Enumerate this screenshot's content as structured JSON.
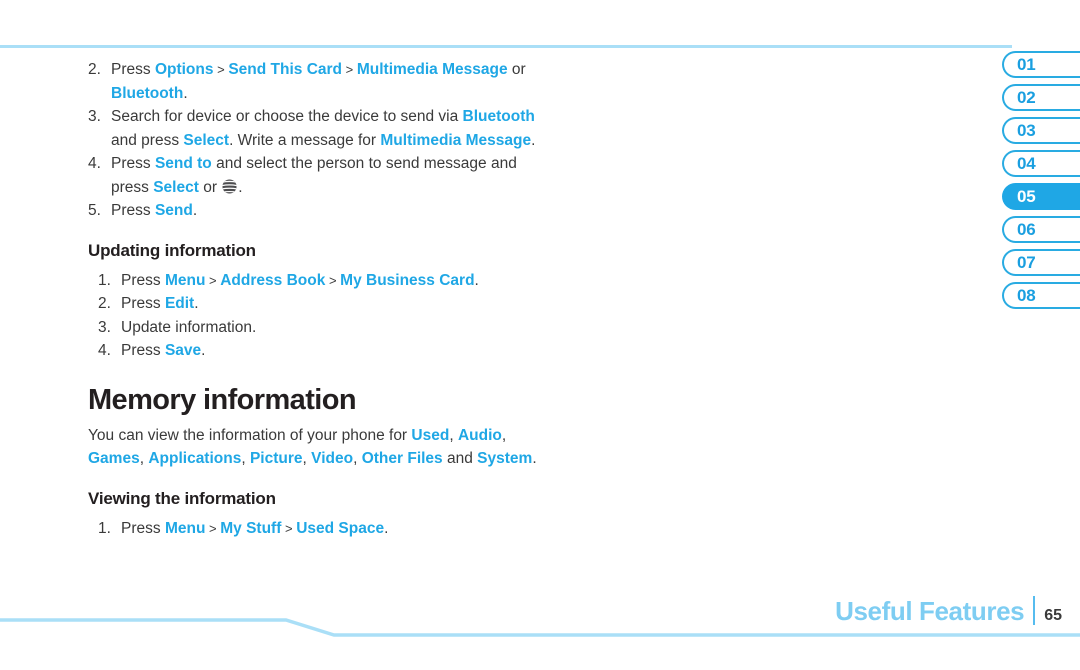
{
  "colors": {
    "accent_blue": "#1fa7e5",
    "light_blue_rule": "#aadff7",
    "tab_border": "#29abe2",
    "tab_active_fill": "#1fa7e5",
    "heading_dark": "#231f20",
    "body_gray": "#3a3a3a",
    "footer_chapter": "#7ecdf2"
  },
  "side_tabs": {
    "items": [
      {
        "label": "01",
        "active": false
      },
      {
        "label": "02",
        "active": false
      },
      {
        "label": "03",
        "active": false
      },
      {
        "label": "04",
        "active": false
      },
      {
        "label": "05",
        "active": true
      },
      {
        "label": "06",
        "active": false
      },
      {
        "label": "07",
        "active": false
      },
      {
        "label": "08",
        "active": false
      }
    ]
  },
  "content": {
    "steps_sending": [
      {
        "marker": "2.",
        "parts": [
          {
            "t": "Press ",
            "style": "plain"
          },
          {
            "t": "Options",
            "style": "blue"
          },
          {
            "t": " > ",
            "style": "gt"
          },
          {
            "t": "Send This Card",
            "style": "blue"
          },
          {
            "t": " > ",
            "style": "gt"
          },
          {
            "t": "Multimedia Message",
            "style": "blue"
          },
          {
            "t": " or ",
            "style": "plain"
          },
          {
            "t": "Bluetooth",
            "style": "blue"
          },
          {
            "t": ".",
            "style": "plain"
          }
        ]
      },
      {
        "marker": "3.",
        "parts": [
          {
            "t": "Search for device or choose the device to send via ",
            "style": "plain"
          },
          {
            "t": "Bluetooth",
            "style": "blue"
          },
          {
            "t": " and press ",
            "style": "plain"
          },
          {
            "t": "Select",
            "style": "blue"
          },
          {
            "t": ". Write a message for ",
            "style": "plain"
          },
          {
            "t": "Multimedia Message",
            "style": "blue"
          },
          {
            "t": ".",
            "style": "plain"
          }
        ]
      },
      {
        "marker": "4.",
        "parts": [
          {
            "t": "Press ",
            "style": "plain"
          },
          {
            "t": "Send to",
            "style": "blue"
          },
          {
            "t": " and select the person to send message and press ",
            "style": "plain"
          },
          {
            "t": "Select",
            "style": "blue"
          },
          {
            "t": " or ",
            "style": "plain"
          },
          {
            "t": "",
            "style": "att-globe-icon"
          },
          {
            "t": ".",
            "style": "plain"
          }
        ]
      },
      {
        "marker": "5.",
        "parts": [
          {
            "t": "Press ",
            "style": "plain"
          },
          {
            "t": "Send",
            "style": "blue"
          },
          {
            "t": ".",
            "style": "plain"
          }
        ]
      }
    ],
    "updating_heading": "Updating information",
    "steps_updating": [
      {
        "marker": "1.",
        "parts": [
          {
            "t": "Press ",
            "style": "plain"
          },
          {
            "t": "Menu",
            "style": "blue"
          },
          {
            "t": " > ",
            "style": "gt"
          },
          {
            "t": "Address Book",
            "style": "blue"
          },
          {
            "t": " > ",
            "style": "gt"
          },
          {
            "t": "My Business Card",
            "style": "blue"
          },
          {
            "t": ".",
            "style": "plain"
          }
        ]
      },
      {
        "marker": "2.",
        "parts": [
          {
            "t": "Press ",
            "style": "plain"
          },
          {
            "t": "Edit",
            "style": "blue"
          },
          {
            "t": ".",
            "style": "plain"
          }
        ]
      },
      {
        "marker": "3.",
        "parts": [
          {
            "t": "Update information.",
            "style": "plain"
          }
        ]
      },
      {
        "marker": "4.",
        "parts": [
          {
            "t": "Press ",
            "style": "plain"
          },
          {
            "t": "Save",
            "style": "blue"
          },
          {
            "t": ".",
            "style": "plain"
          }
        ]
      }
    ],
    "memory_heading": "Memory information",
    "memory_paragraph": [
      {
        "t": "You can view the information of your phone for ",
        "style": "plain"
      },
      {
        "t": "Used",
        "style": "blue"
      },
      {
        "t": ", ",
        "style": "plain"
      },
      {
        "t": "Audio",
        "style": "blue"
      },
      {
        "t": ", ",
        "style": "plain"
      },
      {
        "t": "Games",
        "style": "blue"
      },
      {
        "t": ", ",
        "style": "plain"
      },
      {
        "t": "Applications",
        "style": "blue"
      },
      {
        "t": ", ",
        "style": "plain"
      },
      {
        "t": "Picture",
        "style": "blue"
      },
      {
        "t": ", ",
        "style": "plain"
      },
      {
        "t": "Video",
        "style": "blue"
      },
      {
        "t": ", ",
        "style": "plain"
      },
      {
        "t": "Other Files",
        "style": "blue"
      },
      {
        "t": " and ",
        "style": "plain"
      },
      {
        "t": "System",
        "style": "blue"
      },
      {
        "t": ".",
        "style": "plain"
      }
    ],
    "viewing_heading": "Viewing the information",
    "steps_viewing": [
      {
        "marker": "1.",
        "parts": [
          {
            "t": "Press ",
            "style": "plain"
          },
          {
            "t": "Menu",
            "style": "blue"
          },
          {
            "t": " > ",
            "style": "gt"
          },
          {
            "t": "My Stuff",
            "style": "blue"
          },
          {
            "t": " > ",
            "style": "gt"
          },
          {
            "t": "Used Space",
            "style": "blue"
          },
          {
            "t": ".",
            "style": "plain"
          }
        ]
      }
    ]
  },
  "footer": {
    "chapter": "Useful Features",
    "page_number": "65"
  }
}
